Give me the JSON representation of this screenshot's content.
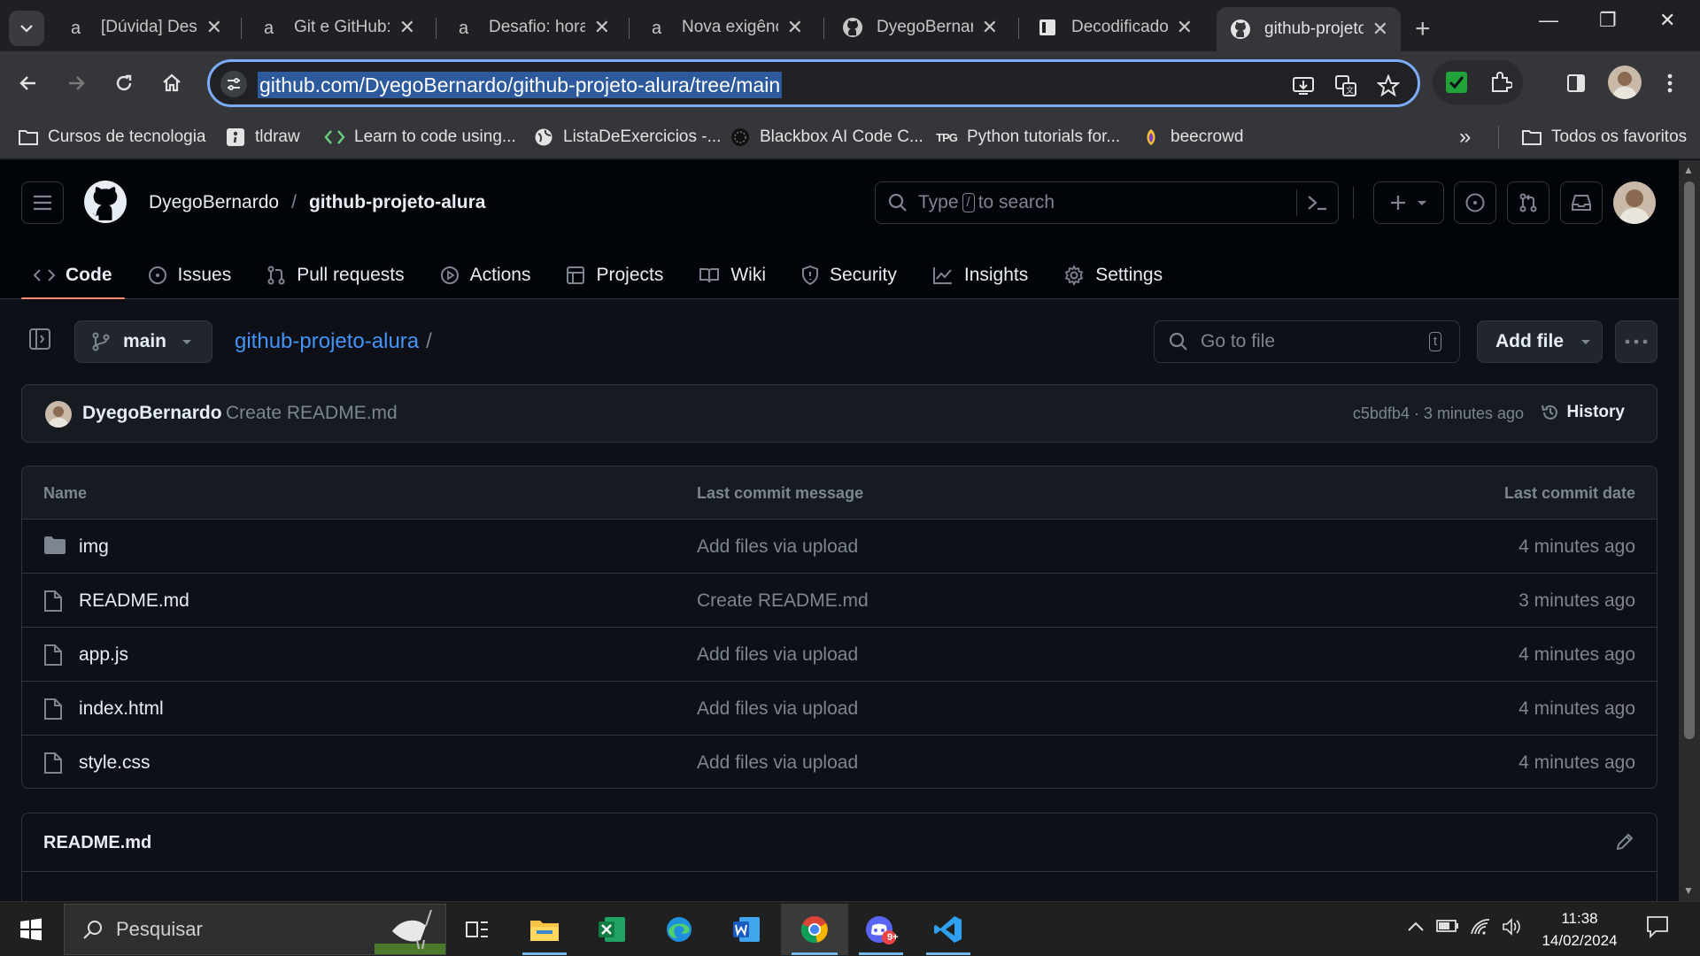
{
  "browser": {
    "tabs": [
      {
        "title": "[Dúvida] Desa",
        "favicon": "alura-icon"
      },
      {
        "title": "Git e GitHub: c",
        "favicon": "alura-icon"
      },
      {
        "title": "Desafio: hora c",
        "favicon": "alura-icon"
      },
      {
        "title": "Nova exigênci",
        "favicon": "alura-icon"
      },
      {
        "title": "DyegoBernardo",
        "favicon": "github-icon"
      },
      {
        "title": "Decodificador",
        "favicon": "document-icon"
      },
      {
        "title": "github-projeto",
        "favicon": "github-icon",
        "active": true
      }
    ],
    "url": "github.com/DyegoBernardo/github-projeto-alura/tree/main",
    "bookmarks": [
      {
        "label": "Cursos de tecnologia",
        "icon": "folder-icon"
      },
      {
        "label": "tldraw",
        "icon": "tldraw-icon"
      },
      {
        "label": "Learn to code using...",
        "icon": "code-icon"
      },
      {
        "label": "ListaDeExercicios -...",
        "icon": "globe-icon"
      },
      {
        "label": "Blackbox AI Code C...",
        "icon": "blackbox-icon"
      },
      {
        "label": "Python tutorials for...",
        "icon": "tpg-icon"
      },
      {
        "label": "beecrowd",
        "icon": "beecrowd-icon"
      }
    ],
    "bookmarks_overflow": "»",
    "all_bookmarks": "Todos os favoritos",
    "tpg_text": "TPG"
  },
  "github": {
    "owner": "DyegoBernardo",
    "path_sep": "/",
    "repo": "github-projeto-alura",
    "search_prefix": "Type",
    "search_key": "/",
    "search_suffix": "to search",
    "nav": [
      "Code",
      "Issues",
      "Pull requests",
      "Actions",
      "Projects",
      "Wiki",
      "Security",
      "Insights",
      "Settings"
    ],
    "branch": "main",
    "crumb_repo": "github-projeto-alura",
    "crumb_sep": "/",
    "goto_file": "Go to file",
    "goto_key": "t",
    "add_file": "Add file",
    "commit": {
      "author": "DyegoBernardo",
      "message": "Create README.md",
      "sha_time": "c5bdfb4 · 3 minutes ago",
      "history": "History"
    },
    "table_headers": {
      "name": "Name",
      "message": "Last commit message",
      "date": "Last commit date"
    },
    "files": [
      {
        "name": "img",
        "type": "folder",
        "message": "Add files via upload",
        "date": "4 minutes ago"
      },
      {
        "name": "README.md",
        "type": "file",
        "message": "Create README.md",
        "date": "3 minutes ago"
      },
      {
        "name": "app.js",
        "type": "file",
        "message": "Add files via upload",
        "date": "4 minutes ago"
      },
      {
        "name": "index.html",
        "type": "file",
        "message": "Add files via upload",
        "date": "4 minutes ago"
      },
      {
        "name": "style.css",
        "type": "file",
        "message": "Add files via upload",
        "date": "4 minutes ago"
      }
    ],
    "readme_title": "README.md"
  },
  "taskbar": {
    "search_placeholder": "Pesquisar",
    "time": "11:38",
    "date": "14/02/2024",
    "discord_badge": "9+"
  },
  "colors": {
    "link": "#4493f8",
    "selected_tab_underline": "#fd8c73",
    "omnibox_focus": "#7cacf8"
  }
}
